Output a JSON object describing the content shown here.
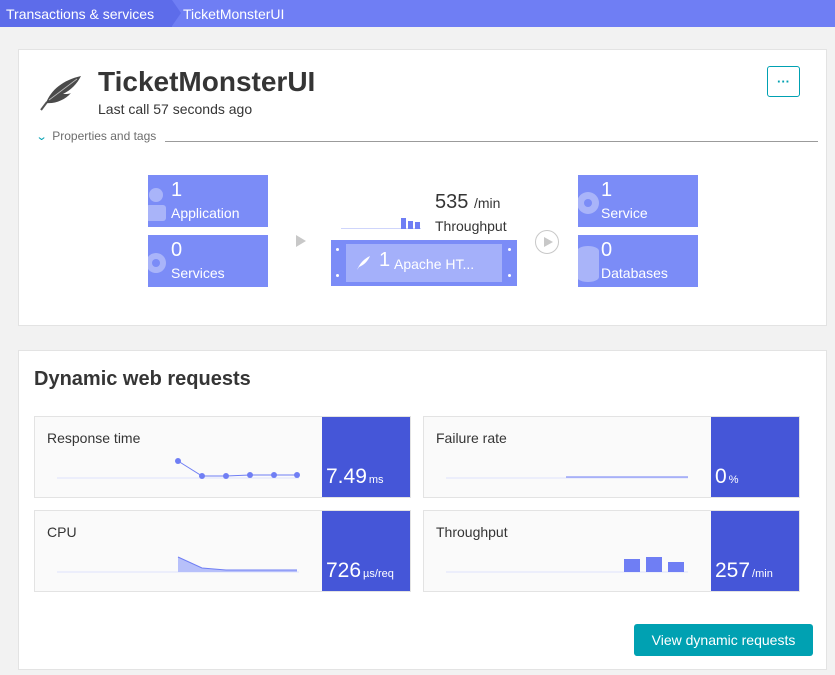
{
  "breadcrumb": {
    "parent": "Transactions & services",
    "current": "TicketMonsterUI"
  },
  "service": {
    "title": "TicketMonsterUI",
    "subtitle": "Last call 57 seconds ago",
    "more_label": "···",
    "properties_label": "Properties and tags"
  },
  "topology": {
    "callers": [
      {
        "count": "1",
        "label": "Application"
      },
      {
        "count": "0",
        "label": "Services"
      }
    ],
    "throughput": {
      "value": "535",
      "unit": "/min",
      "label": "Throughput"
    },
    "host": {
      "count": "1",
      "label": "Apache HT..."
    },
    "callees": [
      {
        "count": "1",
        "label": "Service"
      },
      {
        "count": "0",
        "label": "Databases"
      }
    ]
  },
  "dynamic": {
    "title": "Dynamic web requests",
    "metrics": [
      {
        "name": "Response time",
        "value": "7.49",
        "unit": "ms"
      },
      {
        "name": "Failure rate",
        "value": "0",
        "unit": "%"
      },
      {
        "name": "CPU",
        "value": "726",
        "unit": "µs/req"
      },
      {
        "name": "Throughput",
        "value": "257",
        "unit": "/min"
      }
    ],
    "button_label": "View dynamic requests"
  },
  "colors": {
    "accent": "#00a1b2",
    "tile": "#7b8cf7",
    "value_box": "#4556d8",
    "breadcrumb": "#6f7ef4"
  }
}
